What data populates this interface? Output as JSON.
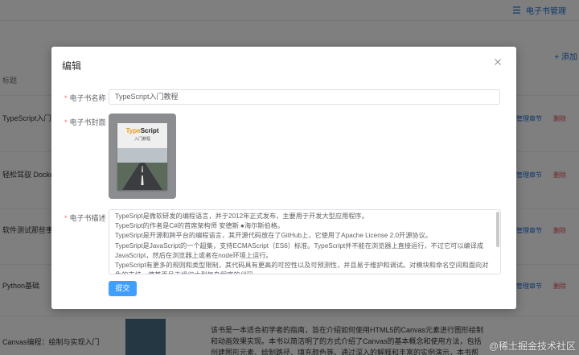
{
  "background": {
    "nav_menu_label": "电子书管理",
    "add_label": "+ 添加",
    "column_title": "标题",
    "rows": [
      {
        "title": "TypeScript入门",
        "manage": "管理章节",
        "delete": "删除"
      },
      {
        "title": "轻松驾驭 Docke",
        "manage": "管理章节",
        "delete": "删除"
      },
      {
        "title": "软件测试那些事",
        "manage": "管理章节",
        "delete": "删除"
      },
      {
        "title": "Python基础",
        "manage": "管理章节",
        "delete": "删除"
      },
      {
        "title": "Canvas编程：绘制与实现入门",
        "manage": "",
        "delete": ""
      }
    ],
    "last_row_desc": "该书是一本适合初学者的指南，旨在介绍如何使用HTML5的Canvas元素进行图形绘制和动画效果实现。本书以简洁明了的方式介绍了Canvas的基本概念和使用方法，包括创建图形元素、绘制路径、填充颜色等。通过深入的解释和丰富的实例演示，本书帮"
  },
  "dialog": {
    "title": "编辑",
    "name_label": "电子书名称",
    "name_value": "TypeScript入门教程",
    "cover_label": "电子书封面",
    "cover_book": {
      "title_ts": "Type",
      "title_script": "Script",
      "subtitle": "入门教程"
    },
    "desc_label": "电子书描述",
    "desc_lines": [
      "TypeSript是微软研发的编程语言，并于2012年正式发布，主要用于开发大型应用程序。",
      "TypeSript的作者是C#的首席架构师 安德斯 ●海尔斯伯格。",
      "TypeSript是开源和跨平台的编程语言，其开源代码放在了GitHub上，它使用了Apache License 2.0开源协议。",
      "TypeSript是JavaScript的一个超集，支持ECMAScript（ES6）标准。TypeScript并不能在浏览器上直接运行，不过它可以编译成JavaScript，然后在浏览器上或者在node环境上运行。",
      "TypeScript有更多的规则和类型限制，其代码具有更高的可控性以及可预测性，并且易于维护和调试。对模块和命名空间和面向对象的支持，使其更易于组织大型复杂程序的代码。"
    ],
    "submit_label": "提交"
  },
  "watermark": "@稀土掘金技术社区",
  "colors": {
    "primary": "#409eff",
    "required": "#f56c6c",
    "link": "#1f6fd6",
    "danger": "#e14b4b"
  }
}
